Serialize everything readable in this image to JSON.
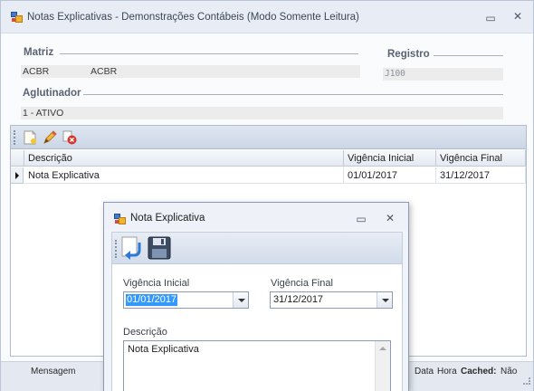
{
  "main_window": {
    "title": "Notas Explicativas - Demonstrações Contábeis (Modo Somente Leitura)",
    "minimize_glyph": "▭",
    "close_glyph": "✕"
  },
  "form": {
    "matriz_label": "Matriz",
    "matriz_code": "ACBR",
    "matriz_name": "ACBR",
    "registro_label": "Registro",
    "registro_value": "J100",
    "aglutinador_label": "Aglutinador",
    "aglutinador_value": "1 - ATIVO"
  },
  "toolbar": {
    "icons": [
      "new-icon",
      "edit-icon",
      "delete-icon"
    ]
  },
  "grid": {
    "columns": [
      "Descrição",
      "Vigência Inicial",
      "Vigência Final"
    ],
    "rows": [
      {
        "descricao": "Nota Explicativa",
        "vigencia_inicial": "01/01/2017",
        "vigencia_final": "31/12/2017"
      }
    ]
  },
  "status_bar": {
    "mensagem": "Mensagem",
    "data": "Data",
    "hora": "Hora",
    "cached_label": "Cached:",
    "cached_value": "Não"
  },
  "dialog": {
    "title": "Nota Explicativa",
    "minimize_glyph": "▭",
    "close_glyph": "✕",
    "toolbar_icons": [
      "undo-icon",
      "save-icon"
    ],
    "vigencia_inicial_label": "Vigência Inicial",
    "vigencia_inicial_value": "01/01/2017",
    "vigencia_final_label": "Vigência Final",
    "vigencia_final_value": "31/12/2017",
    "descricao_label": "Descrição",
    "descricao_value": "Nota Explicativa"
  },
  "colors": {
    "titlebar": "#e8ecf4",
    "toolbar": "#d2dcea",
    "selection": "#3399ff"
  }
}
